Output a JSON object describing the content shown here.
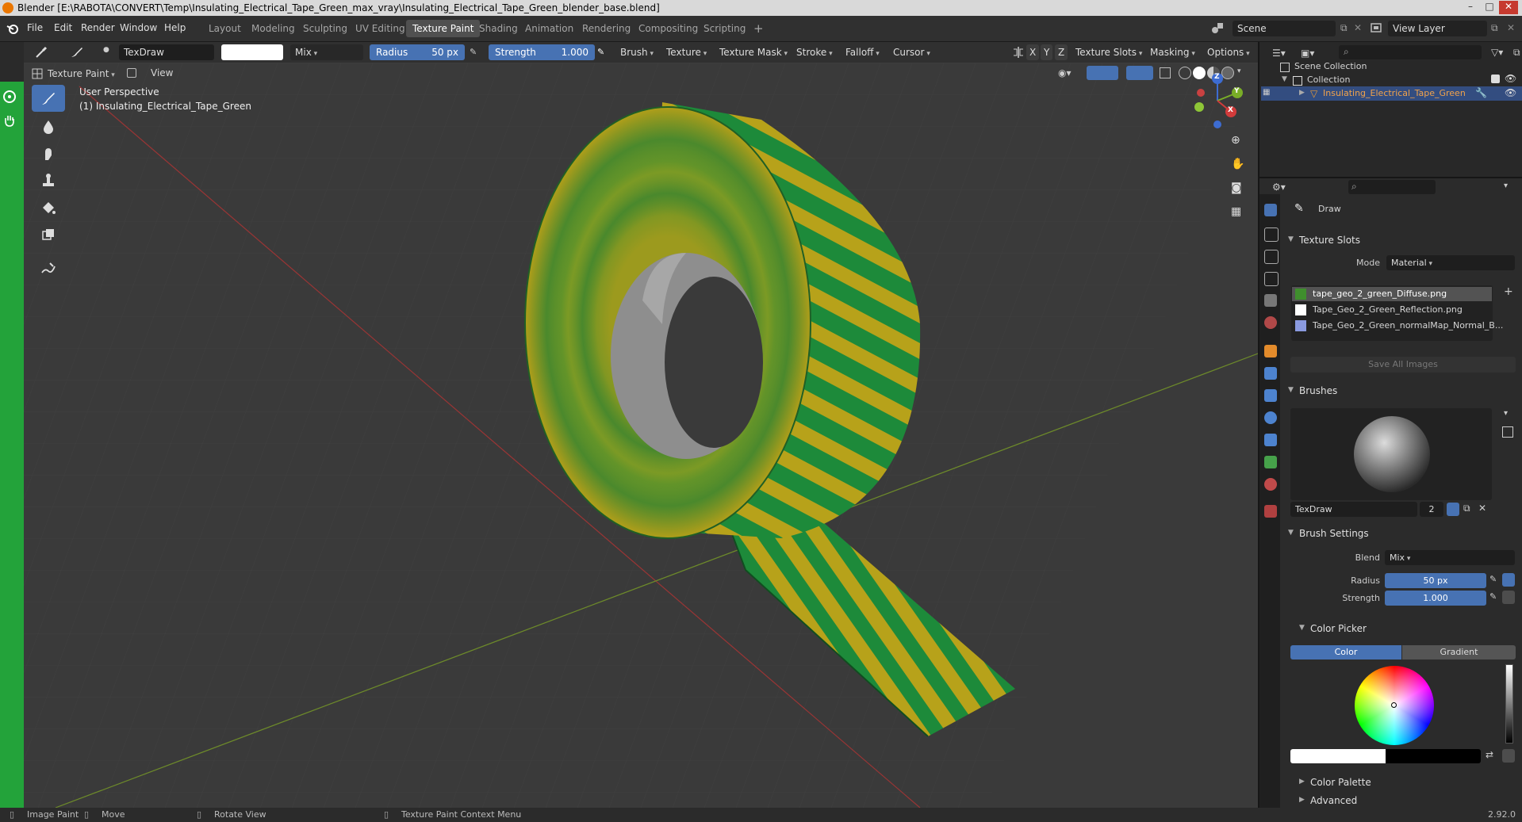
{
  "window": {
    "title": "Blender [E:\\RABOTA\\CONVERT\\Temp\\Insulating_Electrical_Tape_Green_max_vray\\Insulating_Electrical_Tape_Green_blender_base.blend]",
    "controls": [
      "–",
      "□",
      "✕"
    ]
  },
  "menu": {
    "items": [
      "File",
      "Edit",
      "Render",
      "Window",
      "Help"
    ]
  },
  "workspaces": {
    "tabs": [
      "Layout",
      "Modeling",
      "Sculpting",
      "UV Editing",
      "Texture Paint",
      "Shading",
      "Animation",
      "Rendering",
      "Compositing",
      "Scripting"
    ],
    "active": "Texture Paint",
    "add": "+"
  },
  "scene": {
    "scene_name": "Scene",
    "view_layer": "View Layer"
  },
  "tool_header": {
    "brush_name": "TexDraw",
    "blend": "Mix",
    "radius_label": "Radius",
    "radius_value": "50 px",
    "strength_label": "Strength",
    "strength_value": "1.000",
    "menus": [
      "Brush",
      "Texture",
      "Texture Mask",
      "Stroke",
      "Falloff",
      "Cursor"
    ],
    "axes": [
      "X",
      "Y",
      "Z"
    ],
    "right_menus": [
      "Texture Slots",
      "Masking",
      "Options"
    ]
  },
  "viewport_header": {
    "mode": "Texture Paint",
    "view": "View"
  },
  "viewport": {
    "perspective": "User Perspective",
    "object_label": "(1) Insulating_Electrical_Tape_Green",
    "gizmo_axes": [
      "Z",
      "Y",
      "X"
    ],
    "tape_colors": {
      "green": "#1d8a3a",
      "yellow": "#b7a21a",
      "core": "#8e8e8e"
    }
  },
  "outliner": {
    "scene_collection": "Scene Collection",
    "collection": "Collection",
    "object": "Insulating_Electrical_Tape_Green"
  },
  "properties": {
    "tool_name": "Draw",
    "texture_slots": {
      "header": "Texture Slots",
      "mode_label": "Mode",
      "mode_value": "Material",
      "slots": [
        "tape_geo_2_green_Diffuse.png",
        "Tape_Geo_2_Green_Reflection.png",
        "Tape_Geo_2_Green_normalMap_Normal_B..."
      ],
      "save_all": "Save All Images"
    },
    "brushes": {
      "header": "Brushes",
      "brush_name": "TexDraw",
      "users": "2"
    },
    "brush_settings": {
      "header": "Brush Settings",
      "blend_label": "Blend",
      "blend_value": "Mix",
      "radius_label": "Radius",
      "radius_value": "50 px",
      "strength_label": "Strength",
      "strength_value": "1.000"
    },
    "color_picker": {
      "header": "Color Picker",
      "tab_color": "Color",
      "tab_gradient": "Gradient"
    },
    "color_palette": "Color Palette",
    "advanced": "Advanced"
  },
  "statusbar": {
    "items": [
      "Image Paint",
      "Move",
      "Rotate View",
      "Texture Paint Context Menu"
    ],
    "version": "2.92.0"
  }
}
